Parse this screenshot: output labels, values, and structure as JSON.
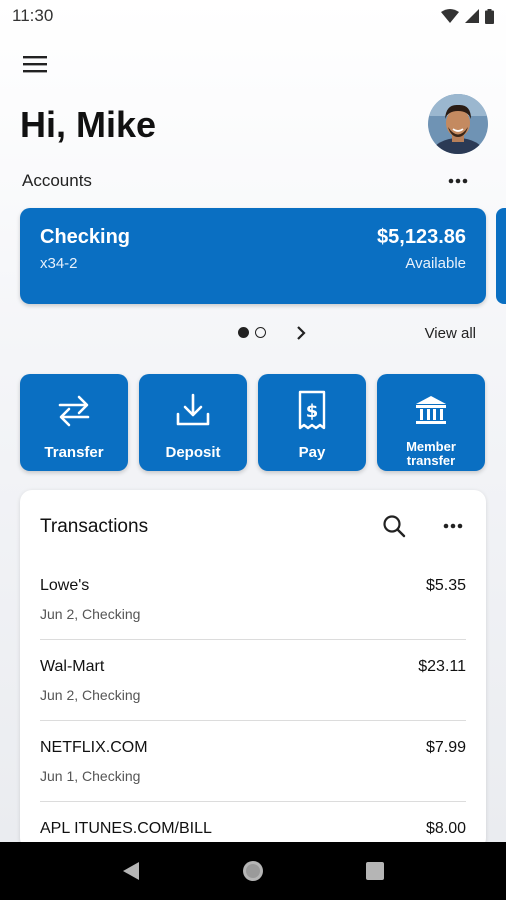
{
  "status_bar": {
    "time": "11:30"
  },
  "header": {
    "greeting": "Hi, Mike"
  },
  "accounts": {
    "label": "Accounts",
    "card": {
      "name": "Checking",
      "number": "x34-2",
      "balance": "$5,123.86",
      "status": "Available"
    },
    "view_all": "View all"
  },
  "actions": [
    {
      "label": "Transfer",
      "icon": "transfer-icon"
    },
    {
      "label": "Deposit",
      "icon": "deposit-icon"
    },
    {
      "label": "Pay",
      "icon": "pay-icon"
    },
    {
      "label": "Member transfer",
      "icon": "bank-icon"
    }
  ],
  "transactions": {
    "title": "Transactions",
    "items": [
      {
        "merchant": "Lowe's",
        "meta": "Jun 2, Checking",
        "amount": "$5.35"
      },
      {
        "merchant": "Wal-Mart",
        "meta": "Jun 2, Checking",
        "amount": "$23.11"
      },
      {
        "merchant": "NETFLIX.COM",
        "meta": "Jun 1, Checking",
        "amount": "$7.99"
      },
      {
        "merchant": "APL ITUNES.COM/BILL",
        "meta": "",
        "amount": "$8.00"
      }
    ]
  },
  "colors": {
    "accent": "#0a6fc2",
    "nav_bar": "#000000"
  }
}
